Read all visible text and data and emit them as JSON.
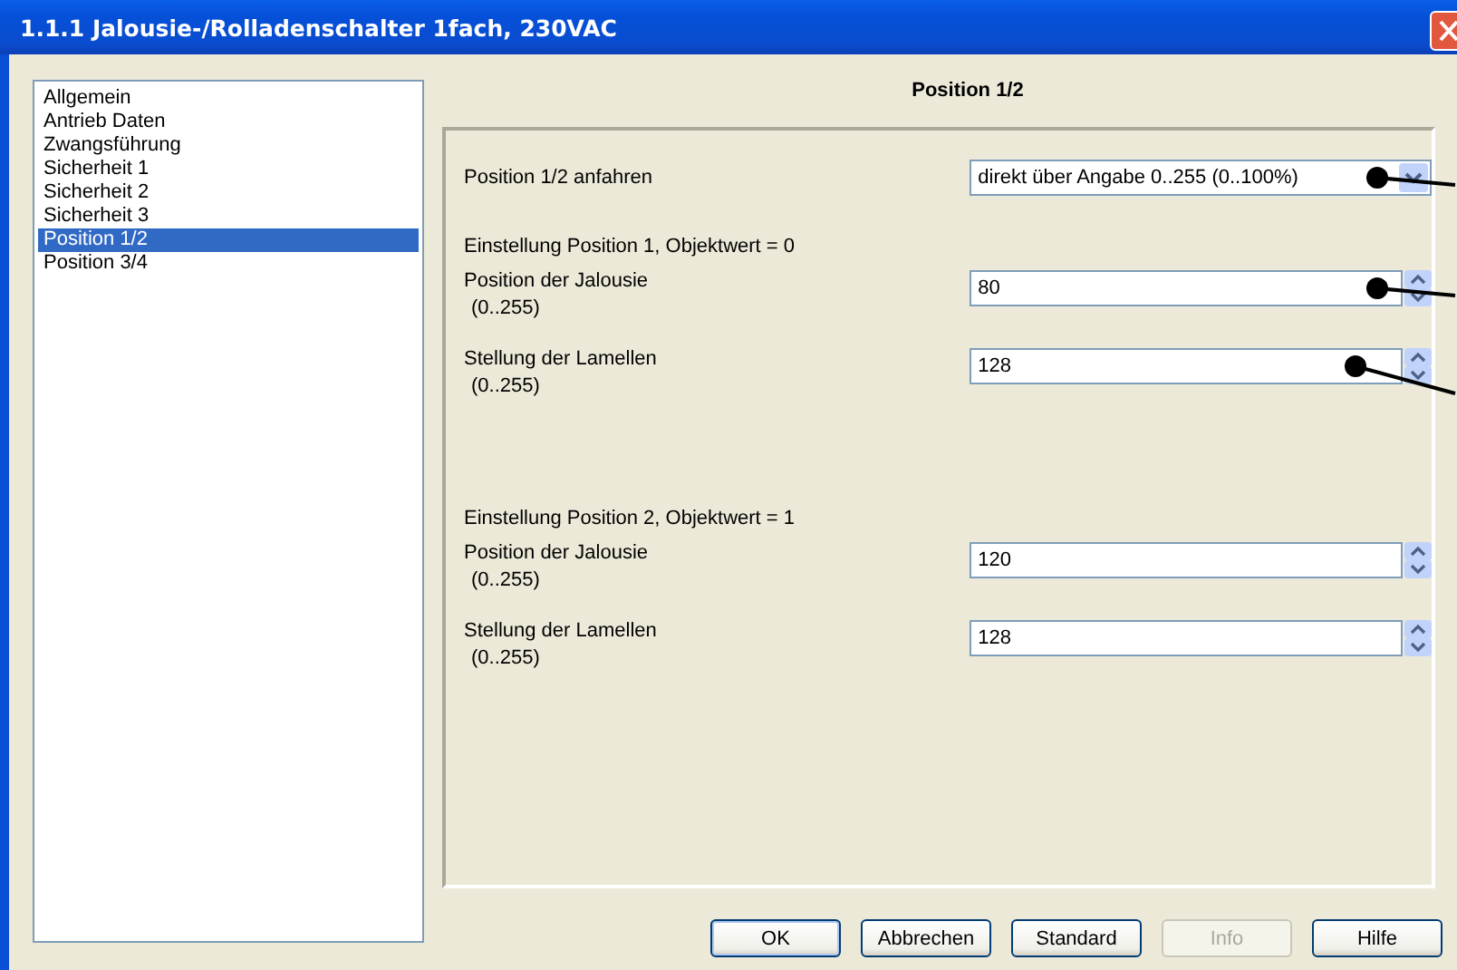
{
  "window": {
    "title": "1.1.1 Jalousie-/Rolladenschalter 1fach, 230VAC"
  },
  "sidebar": {
    "items": [
      {
        "label": "Allgemein",
        "selected": false
      },
      {
        "label": "Antrieb Daten",
        "selected": false
      },
      {
        "label": "Zwangsführung",
        "selected": false
      },
      {
        "label": "Sicherheit 1",
        "selected": false
      },
      {
        "label": "Sicherheit 2",
        "selected": false
      },
      {
        "label": "Sicherheit 3",
        "selected": false
      },
      {
        "label": "Position 1/2",
        "selected": true
      },
      {
        "label": "Position 3/4",
        "selected": false
      }
    ]
  },
  "panel": {
    "title": "Position 1/2",
    "rows": [
      {
        "kind": "dropdown",
        "label": "Position 1/2 anfahren",
        "value": "direkt über Angabe 0..255 (0..100%)",
        "marked": true
      },
      {
        "kind": "heading",
        "label": "Einstellung Position 1, Objektwert = 0"
      },
      {
        "kind": "spin",
        "label": "Position der Jalousie",
        "range": "(0..255)",
        "value": "80",
        "marked": true
      },
      {
        "kind": "spin",
        "label": "Stellung der Lamellen",
        "range": "(0..255)",
        "value": "128",
        "marked": true
      },
      {
        "kind": "spacer"
      },
      {
        "kind": "heading",
        "label": "Einstellung Position 2, Objektwert = 1"
      },
      {
        "kind": "spin",
        "label": "Position der Jalousie",
        "range": "(0..255)",
        "value": "120",
        "marked": false
      },
      {
        "kind": "spin",
        "label": "Stellung der Lamellen",
        "range": "(0..255)",
        "value": "128",
        "marked": false
      }
    ]
  },
  "buttons": [
    {
      "label": "OK",
      "disabled": false,
      "default": true
    },
    {
      "label": "Abbrechen",
      "disabled": false,
      "default": false
    },
    {
      "label": "Standard",
      "disabled": false,
      "default": false
    },
    {
      "label": "Info",
      "disabled": true,
      "default": false
    },
    {
      "label": "Hilfe",
      "disabled": false,
      "default": false
    }
  ]
}
